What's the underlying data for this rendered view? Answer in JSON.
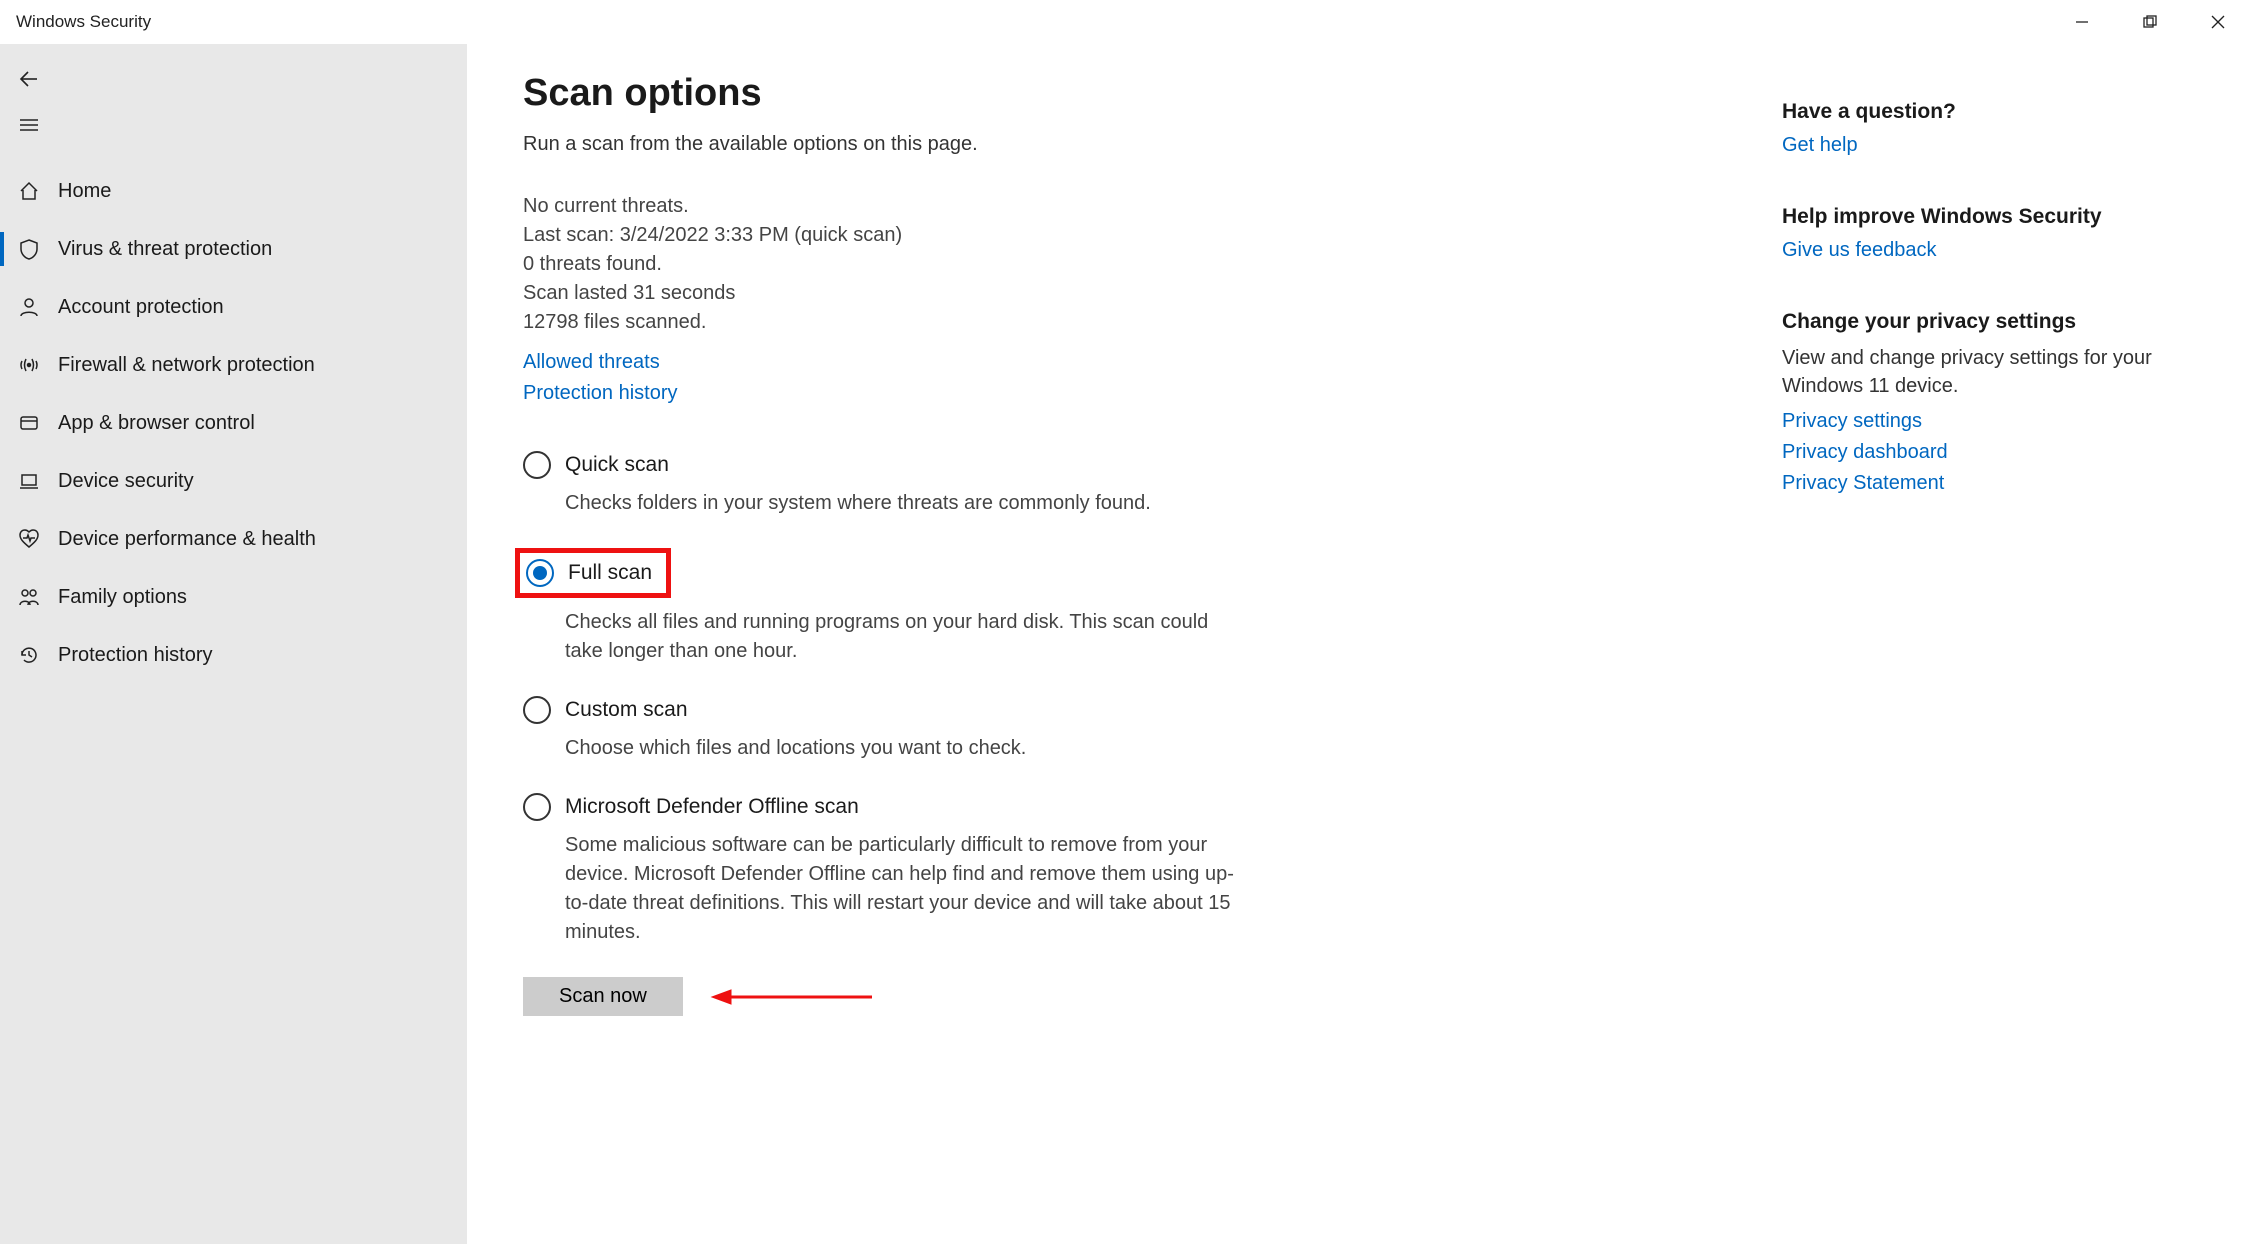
{
  "window": {
    "title": "Windows Security"
  },
  "sidebar": {
    "items": [
      {
        "label": "Home"
      },
      {
        "label": "Virus & threat protection"
      },
      {
        "label": "Account protection"
      },
      {
        "label": "Firewall & network protection"
      },
      {
        "label": "App & browser control"
      },
      {
        "label": "Device security"
      },
      {
        "label": "Device performance & health"
      },
      {
        "label": "Family options"
      },
      {
        "label": "Protection history"
      }
    ]
  },
  "page": {
    "title": "Scan options",
    "subtitle": "Run a scan from the available options on this page.",
    "status": {
      "no_threats": "No current threats.",
      "last_scan": "Last scan: 3/24/2022 3:33 PM (quick scan)",
      "threats_found": "0 threats found.",
      "duration": "Scan lasted 31 seconds",
      "files": "12798 files scanned."
    },
    "links": {
      "allowed": "Allowed threats",
      "history": "Protection history"
    },
    "options": [
      {
        "label": "Quick scan",
        "desc": "Checks folders in your system where threats are commonly found.",
        "checked": false,
        "highlight": false
      },
      {
        "label": "Full scan",
        "desc": "Checks all files and running programs on your hard disk. This scan could take longer than one hour.",
        "checked": true,
        "highlight": true
      },
      {
        "label": "Custom scan",
        "desc": "Choose which files and locations you want to check.",
        "checked": false,
        "highlight": false
      },
      {
        "label": "Microsoft Defender Offline scan",
        "desc": "Some malicious software can be particularly difficult to remove from your device. Microsoft Defender Offline can help find and remove them using up-to-date threat definitions. This will restart your device and will take about 15 minutes.",
        "checked": false,
        "highlight": false
      }
    ],
    "scan_button": "Scan now"
  },
  "rail": {
    "q_heading": "Have a question?",
    "q_link": "Get help",
    "improve_heading": "Help improve Windows Security",
    "improve_link": "Give us feedback",
    "privacy_heading": "Change your privacy settings",
    "privacy_text": "View and change privacy settings for your Windows 11 device.",
    "privacy_links": {
      "settings": "Privacy settings",
      "dashboard": "Privacy dashboard",
      "statement": "Privacy Statement"
    }
  }
}
